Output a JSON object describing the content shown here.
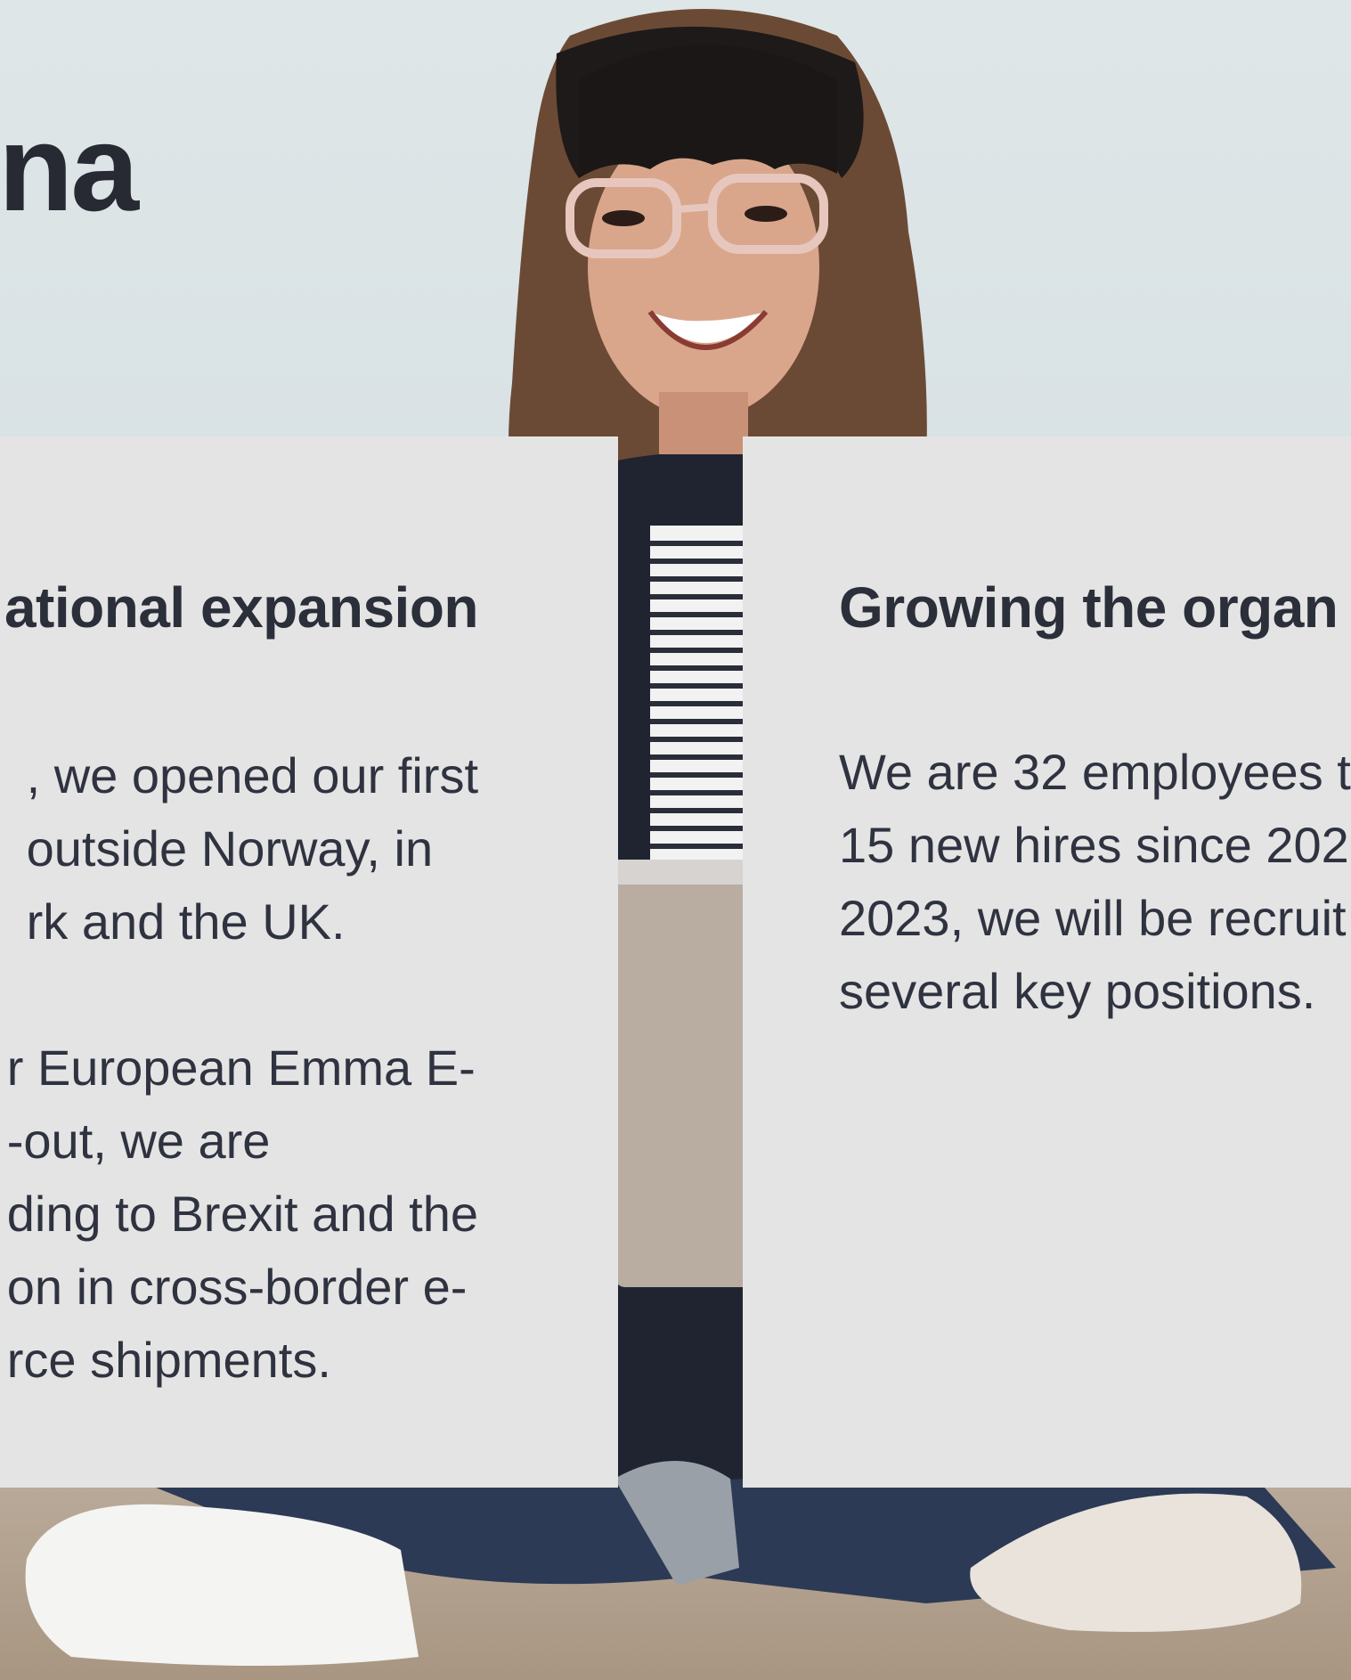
{
  "hero": {
    "title": "na",
    "colors": {
      "background": "#dfe6e8",
      "card": "#e4e4e4",
      "text": "#2b2f3a"
    }
  },
  "cards": {
    "left": {
      "heading": "ational expansion",
      "paragraph_1": [
        ", we opened our first",
        "outside Norway, in",
        "rk and the UK."
      ],
      "paragraph_2": [
        "r European Emma E-",
        "-out, we are",
        "ding to Brexit and the",
        "on in cross-border e-",
        "rce shipments."
      ]
    },
    "right": {
      "heading": "Growing the organ",
      "paragraph_1": [
        "We are 32 employees t",
        "15 new hires since 202",
        "2023, we will be recruit",
        "several key positions."
      ]
    }
  }
}
